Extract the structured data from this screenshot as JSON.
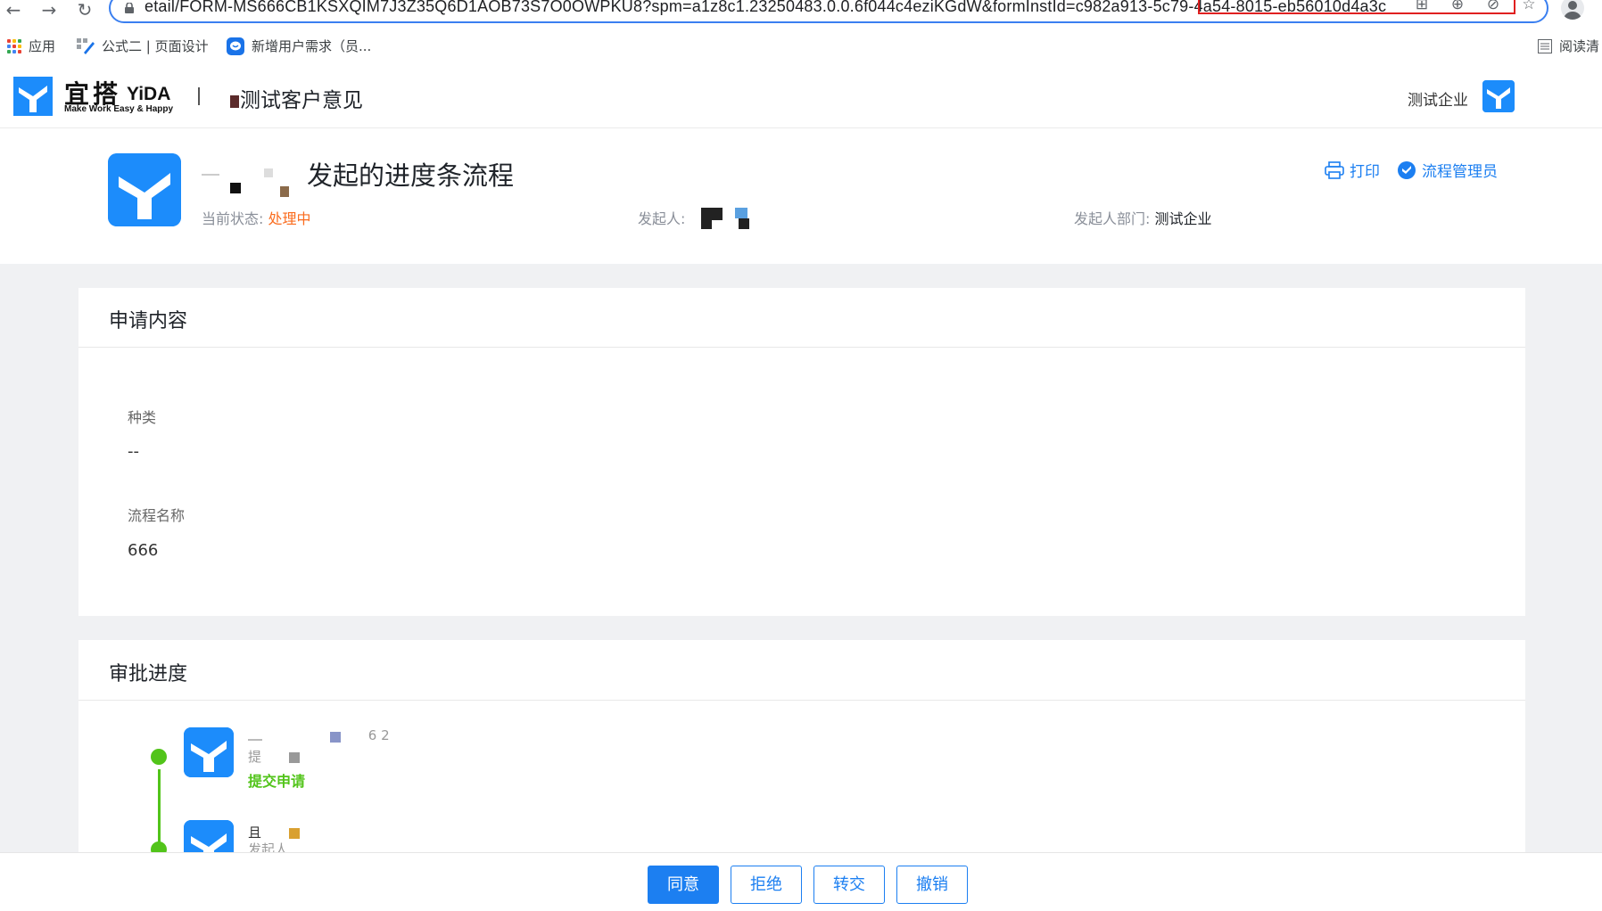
{
  "browser": {
    "url": "etail/FORM-MS666CB1KSXQIM7J3Z35Q6D1AOB73S7O0OWPKU8?spm=a1z8c1.23250483.0.0.6f044c4eziKGdW&formInstId=c982a913-5c79-4a54-8015-eb56010d4a3c",
    "bookmarks": [
      "应用",
      "公式二 | 页面设计",
      "新增用户需求（员..."
    ],
    "reading_list": "阅读清"
  },
  "header": {
    "logo_cn": "宜搭",
    "logo_en": "YiDA",
    "logo_slogan": "Make Work Easy & Happy",
    "app_title": "测试客户意见",
    "corp_name": "测试企业"
  },
  "summary": {
    "title": "发起的进度条流程",
    "status_label": "当前状态:",
    "status_value": "处理中",
    "initiator_label": "发起人:",
    "dept_label": "发起人部门:",
    "dept_value": "测试企业",
    "print_label": "打印",
    "admin_label": "流程管理员"
  },
  "apply": {
    "title": "申请内容",
    "fields": [
      {
        "label": "种类",
        "value": "--"
      },
      {
        "label": "流程名称",
        "value": "666"
      }
    ]
  },
  "approval": {
    "title": "审批进度",
    "steps": [
      {
        "time": "6 2",
        "action": "提",
        "status": "提交申请"
      },
      {
        "name": "且",
        "role": "发起人"
      }
    ]
  },
  "actions": {
    "agree": "同意",
    "reject": "拒绝",
    "transfer": "转交",
    "revoke": "撤销"
  },
  "colors": {
    "brand_blue": "#1c8cfb",
    "link_blue": "#1c7ff1",
    "status_orange": "#fa6c1e",
    "success_green": "#52c41a"
  }
}
